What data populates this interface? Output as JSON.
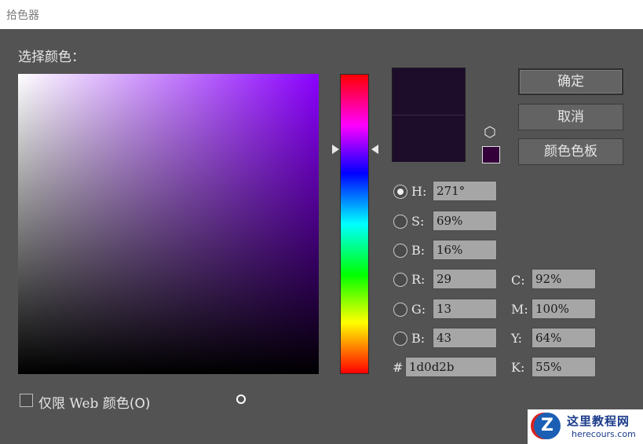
{
  "window": {
    "title": "拾色器"
  },
  "picker": {
    "heading": "选择颜色："
  },
  "buttons": {
    "ok": "确定",
    "cancel": "取消",
    "swatches": "颜色色板"
  },
  "fields": {
    "H": {
      "label": "H:",
      "value": "271°",
      "selected": true
    },
    "S": {
      "label": "S:",
      "value": "69%"
    },
    "Bri": {
      "label": "B:",
      "value": "16%"
    },
    "R": {
      "label": "R:",
      "value": "29"
    },
    "G": {
      "label": "G:",
      "value": "13"
    },
    "Blue": {
      "label": "B:",
      "value": "43"
    },
    "C": {
      "label": "C:",
      "value": "92%"
    },
    "M": {
      "label": "M:",
      "value": "100%"
    },
    "Y": {
      "label": "Y:",
      "value": "64%"
    },
    "K": {
      "label": "K:",
      "value": "55%"
    },
    "hex": {
      "label": "#",
      "value": "1d0d2b"
    }
  },
  "web_only": {
    "label_prefix": "仅限",
    "label_web": "Web",
    "label_suffix": "颜色(O)",
    "checked": false
  },
  "colors": {
    "current": "#1d0d2b",
    "websafe": "#33003a",
    "hue_base": "#8b00ff"
  },
  "watermark": {
    "site_name": "这里教程网",
    "url": "herecours.com"
  },
  "icons": {
    "cube": "cube-icon",
    "websafe": "websafe-swatch"
  }
}
